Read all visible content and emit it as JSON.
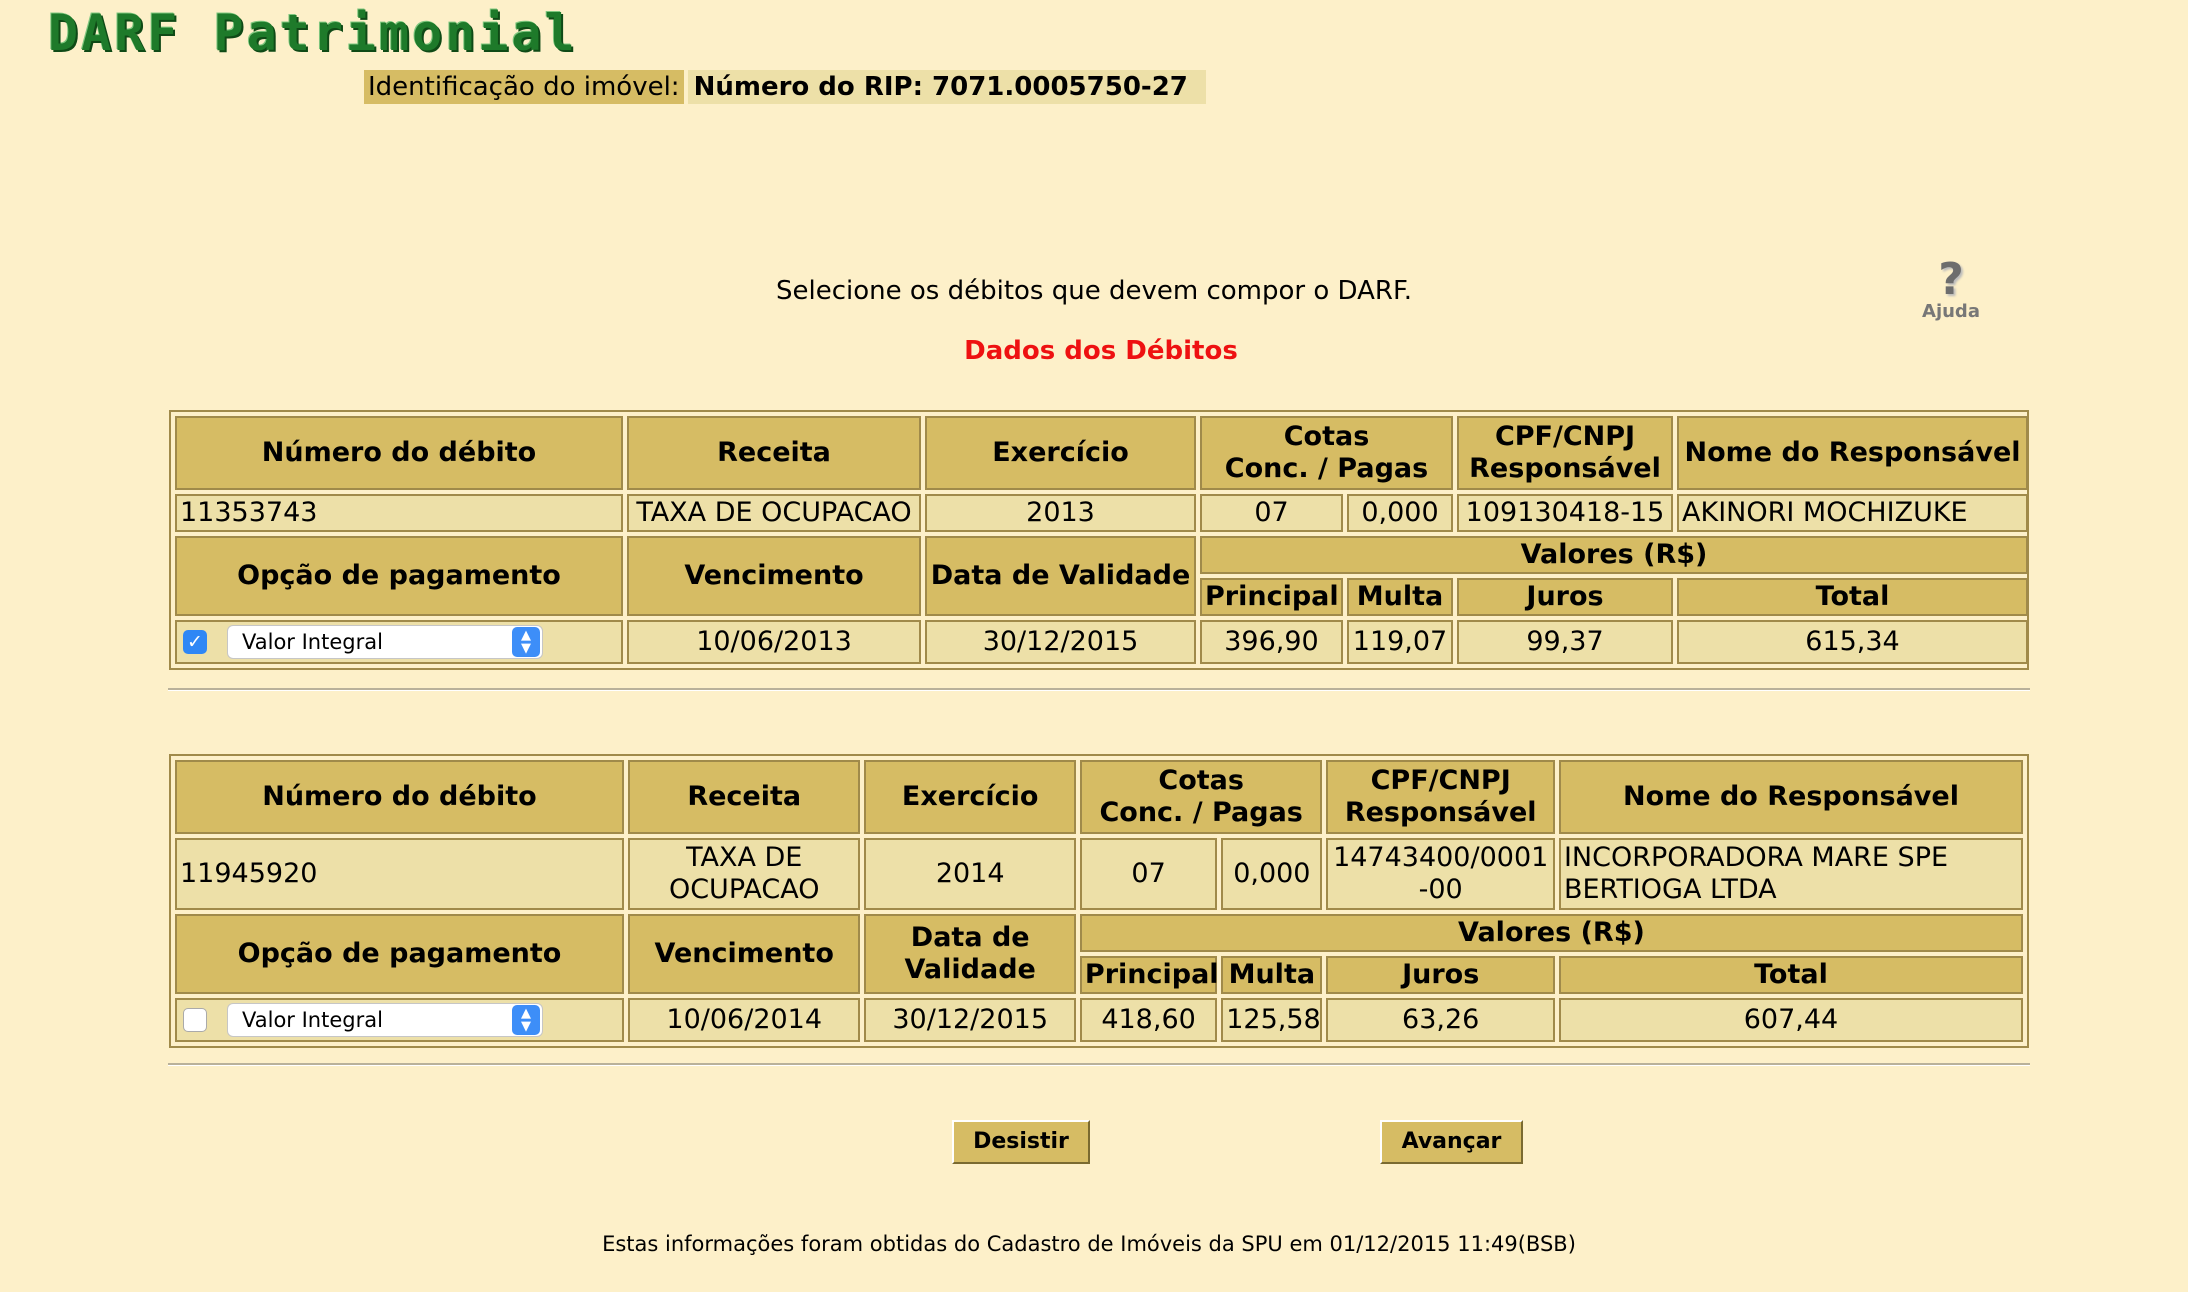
{
  "app": {
    "logo": "DARF Patrimonial"
  },
  "ident": {
    "label": "Identificação do imóvel:",
    "value": "Número do RIP: 7071.0005750-27"
  },
  "instruction": "Selecione os débitos que devem compor o DARF.",
  "help": {
    "label": "Ajuda"
  },
  "section_title": "Dados dos Débitos",
  "headers": {
    "numero": "Número do débito",
    "receita": "Receita",
    "exercicio": "Exercício",
    "cotas": "Cotas\nConc. / Pagas",
    "cpf": "CPF/CNPJ\nResponsável",
    "nome": "Nome do Responsável",
    "opcao": "Opção de pagamento",
    "vencimento": "Vencimento",
    "validade": "Data de Validade",
    "valores": "Valores (R$)",
    "principal": "Principal",
    "multa": "Multa",
    "juros": "Juros",
    "total": "Total"
  },
  "debts": [
    {
      "numero": "11353743",
      "receita": "TAXA DE OCUPACAO",
      "exercicio": "2013",
      "cotas_conc": "07",
      "cotas_pagas": "0,000",
      "cpf": "109130418-15",
      "nome": "AKINORI MOCHIZUKE",
      "checked": true,
      "opcao": "Valor Integral",
      "vencimento": "10/06/2013",
      "validade": "30/12/2015",
      "principal": "396,90",
      "multa": "119,07",
      "juros": "99,37",
      "total": "615,34"
    },
    {
      "numero": "11945920",
      "receita": "TAXA DE OCUPACAO",
      "exercicio": "2014",
      "cotas_conc": "07",
      "cotas_pagas": "0,000",
      "cpf": "14743400/0001-00",
      "nome": "INCORPORADORA MARE SPE BERTIOGA LTDA",
      "checked": false,
      "opcao": "Valor Integral",
      "vencimento": "10/06/2014",
      "validade": "30/12/2015",
      "principal": "418,60",
      "multa": "125,58",
      "juros": "63,26",
      "total": "607,44"
    }
  ],
  "buttons": {
    "cancel": "Desistir",
    "next": "Avançar"
  },
  "footer": "Estas informações foram obtidas do Cadastro de Imóveis da SPU em 01/12/2015 11:49(BSB)"
}
